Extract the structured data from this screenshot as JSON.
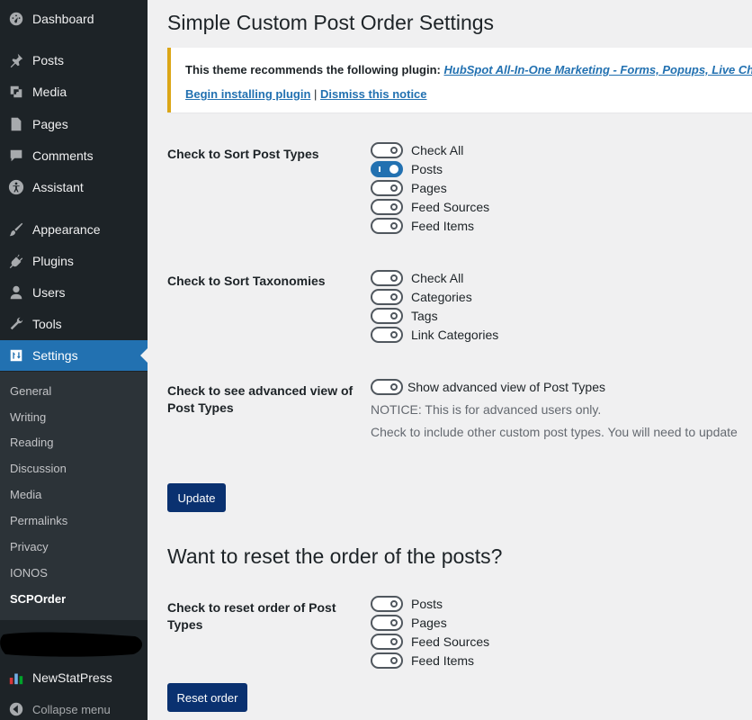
{
  "sidebar": {
    "items": [
      {
        "label": "Dashboard",
        "icon": "dashboard-icon"
      },
      {
        "label": "Posts",
        "icon": "pin-icon"
      },
      {
        "label": "Media",
        "icon": "media-icon"
      },
      {
        "label": "Pages",
        "icon": "page-icon"
      },
      {
        "label": "Comments",
        "icon": "comment-icon"
      },
      {
        "label": "Assistant",
        "icon": "accessibility-icon"
      },
      {
        "label": "Appearance",
        "icon": "brush-icon"
      },
      {
        "label": "Plugins",
        "icon": "plug-icon"
      },
      {
        "label": "Users",
        "icon": "user-icon"
      },
      {
        "label": "Tools",
        "icon": "wrench-icon"
      },
      {
        "label": "Settings",
        "icon": "settings-icon"
      }
    ],
    "submenu": [
      "General",
      "Writing",
      "Reading",
      "Discussion",
      "Media",
      "Permalinks",
      "Privacy",
      "IONOS",
      "SCPOrder"
    ],
    "newstatpress": "NewStatPress",
    "collapse": "Collapse menu"
  },
  "page": {
    "title": "Simple Custom Post Order Settings",
    "notice": {
      "text": "This theme recommends the following plugin:",
      "plugin_link": "HubSpot All-In-One Marketing - Forms, Popups, Live Chat",
      "suffix": ".",
      "begin_link": "Begin installing plugin",
      "separator": "|",
      "dismiss_link": "Dismiss this notice"
    },
    "sort_post_types": {
      "label": "Check to Sort Post Types",
      "options": [
        {
          "label": "Check All",
          "checked": false
        },
        {
          "label": "Posts",
          "checked": true
        },
        {
          "label": "Pages",
          "checked": false
        },
        {
          "label": "Feed Sources",
          "checked": false
        },
        {
          "label": "Feed Items",
          "checked": false
        }
      ]
    },
    "sort_taxonomies": {
      "label": "Check to Sort Taxonomies",
      "options": [
        {
          "label": "Check All",
          "checked": false
        },
        {
          "label": "Categories",
          "checked": false
        },
        {
          "label": "Tags",
          "checked": false
        },
        {
          "label": "Link Categories",
          "checked": false
        }
      ]
    },
    "advanced": {
      "label_line1": "Check to see advanced view of",
      "label_line2": "Post Types",
      "option": "Show advanced view of Post Types",
      "notice1": "NOTICE: This is for advanced users only.",
      "notice2": "Check to include other custom post types. You will need to update"
    },
    "update_button": "Update",
    "reset_heading": "Want to reset the order of the posts?",
    "reset": {
      "label_line1": "Check to reset order of Post",
      "label_line2": "Types",
      "options": [
        {
          "label": "Posts",
          "checked": false
        },
        {
          "label": "Pages",
          "checked": false
        },
        {
          "label": "Feed Sources",
          "checked": false
        },
        {
          "label": "Feed Items",
          "checked": false
        }
      ]
    },
    "reset_button": "Reset order"
  },
  "colors": {
    "sidebar_bg": "#1d2327",
    "submenu_bg": "#2c3338",
    "active_bg": "#2271b1",
    "button_bg": "#0a3170",
    "notice_border": "#dba617",
    "link": "#2271b1"
  }
}
